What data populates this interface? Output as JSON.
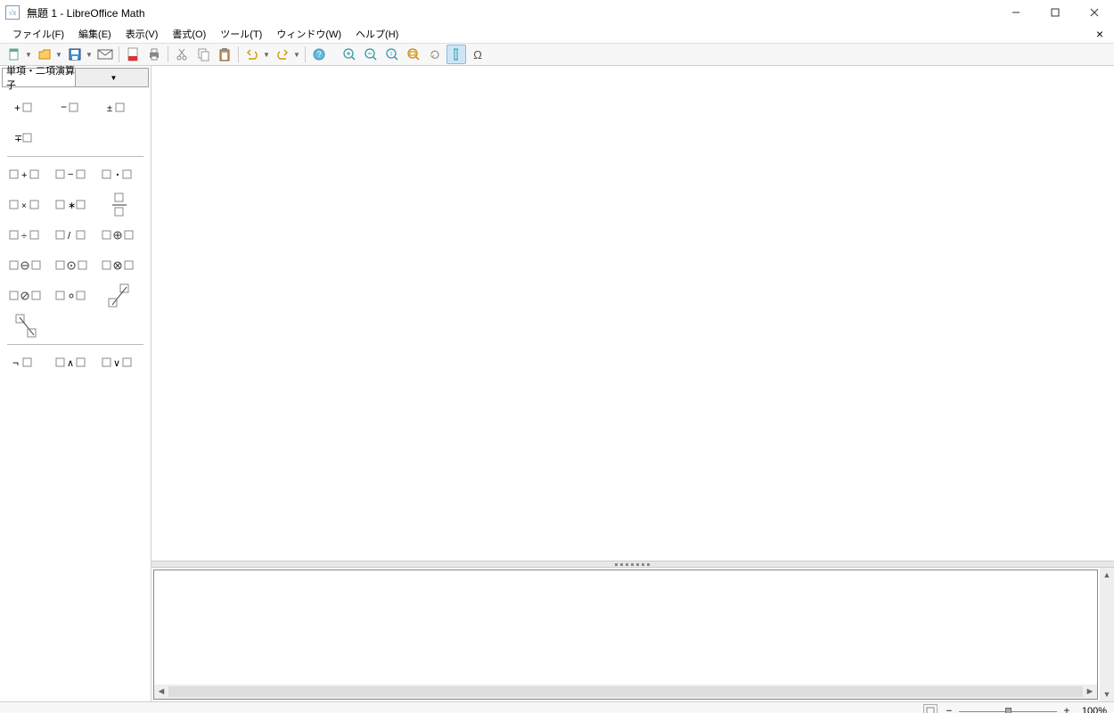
{
  "window": {
    "title": "無題 1 - LibreOffice Math"
  },
  "menu": {
    "file": "ファイル(F)",
    "edit": "編集(E)",
    "view": "表示(V)",
    "format": "書式(O)",
    "tools": "ツール(T)",
    "window": "ウィンドウ(W)",
    "help": "ヘルプ(H)"
  },
  "category_selector": {
    "current": "単項・二項演算子"
  },
  "palette_ops": {
    "row1": [
      "plus-a",
      "minus-a",
      "plusminus-a"
    ],
    "row2": [
      "minusplus-a"
    ],
    "row3": [
      "a-plus-b",
      "a-minus-b",
      "a-dot-b"
    ],
    "row4": [
      "a-times-b",
      "a-ast-b",
      "a-over-b"
    ],
    "row5": [
      "a-div-b",
      "a-slash-b",
      "a-oplus-b"
    ],
    "row6": [
      "a-ominus-b",
      "a-odot-b",
      "a-otimes-b"
    ],
    "row7": [
      "a-oslash-b",
      "a-circ-b",
      "a-wideslash-b"
    ],
    "row8": [
      "a-widebslash-b"
    ],
    "row9": [
      "neg-a",
      "a-and-b",
      "a-or-b"
    ]
  },
  "status": {
    "zoom_value": "100%"
  }
}
